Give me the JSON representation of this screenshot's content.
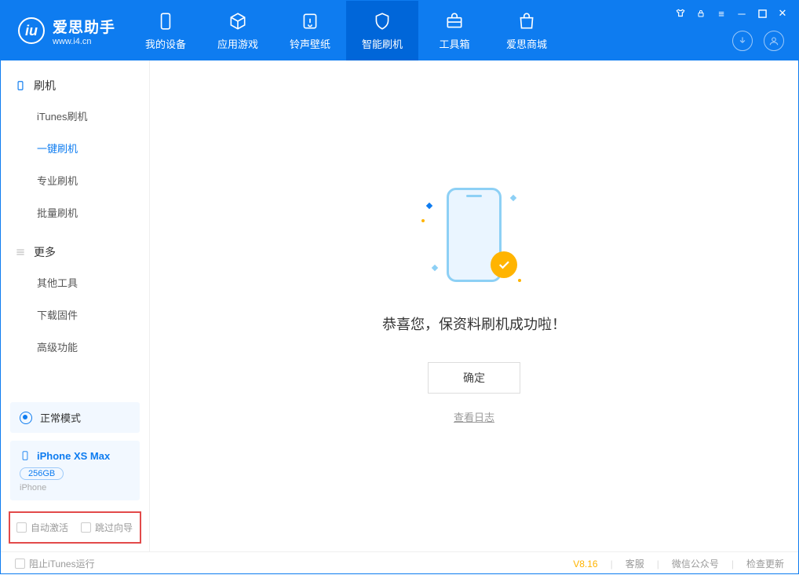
{
  "app": {
    "title": "爱思助手",
    "subtitle": "www.i4.cn"
  },
  "tabs": {
    "device": "我的设备",
    "apps": "应用游戏",
    "ring": "铃声壁纸",
    "flash": "智能刷机",
    "tools": "工具箱",
    "store": "爱思商城"
  },
  "sidebar": {
    "group1": "刷机",
    "items1": [
      "iTunes刷机",
      "一键刷机",
      "专业刷机",
      "批量刷机"
    ],
    "group2": "更多",
    "items2": [
      "其他工具",
      "下载固件",
      "高级功能"
    ]
  },
  "mode": "正常模式",
  "device": {
    "name": "iPhone XS Max",
    "capacity": "256GB",
    "type": "iPhone"
  },
  "checks": {
    "auto_activate": "自动激活",
    "skip_guide": "跳过向导"
  },
  "main": {
    "success": "恭喜您，保资料刷机成功啦！",
    "ok": "确定",
    "log": "查看日志"
  },
  "footer": {
    "block_itunes": "阻止iTunes运行",
    "version": "V8.16",
    "cs": "客服",
    "wechat": "微信公众号",
    "update": "检查更新"
  }
}
